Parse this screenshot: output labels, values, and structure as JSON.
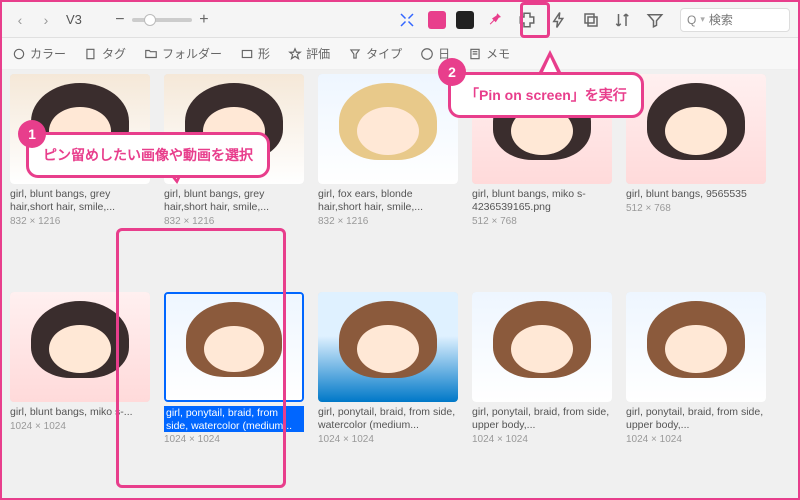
{
  "breadcrumb": "V3",
  "search": {
    "placeholder": "検索"
  },
  "filters": {
    "color": "カラー",
    "tag": "タグ",
    "folder": "フォルダー",
    "shape": "形",
    "rating": "評価",
    "type": "タイプ",
    "date": "日",
    "memo": "メモ"
  },
  "annotations": {
    "step1_num": "1",
    "step1_text": "ピン留めしたい画像や動画を選択",
    "step2_num": "2",
    "step2_text": "「Pin on screen」を実行"
  },
  "cards": [
    {
      "caption": "girl, blunt bangs, grey hair,short hair, smile,...",
      "dim": "832 × 1216"
    },
    {
      "caption": "girl, blunt bangs, grey hair,short hair, smile,...",
      "dim": "832 × 1216"
    },
    {
      "caption": "girl, fox ears, blonde hair,short hair, smile,...",
      "dim": "832 × 1216"
    },
    {
      "caption": "girl, blunt bangs, miko s-4236539165.png",
      "dim": "512 × 768"
    },
    {
      "caption": "girl, blunt bangs, 9565535",
      "dim": "512 × 768"
    },
    {
      "caption": "girl, blunt bangs, miko s-...",
      "dim": "1024 × 1024"
    },
    {
      "caption": "girl, ponytail, braid, from side, watercolor (medium...",
      "dim": "1024 × 1024"
    },
    {
      "caption": "girl, ponytail, braid, from side, watercolor (medium...",
      "dim": "1024 × 1024"
    },
    {
      "caption": "girl, ponytail, braid, from side, upper body,...",
      "dim": "1024 × 1024"
    },
    {
      "caption": "girl, ponytail, braid, from side, upper body,...",
      "dim": "1024 × 1024"
    }
  ]
}
